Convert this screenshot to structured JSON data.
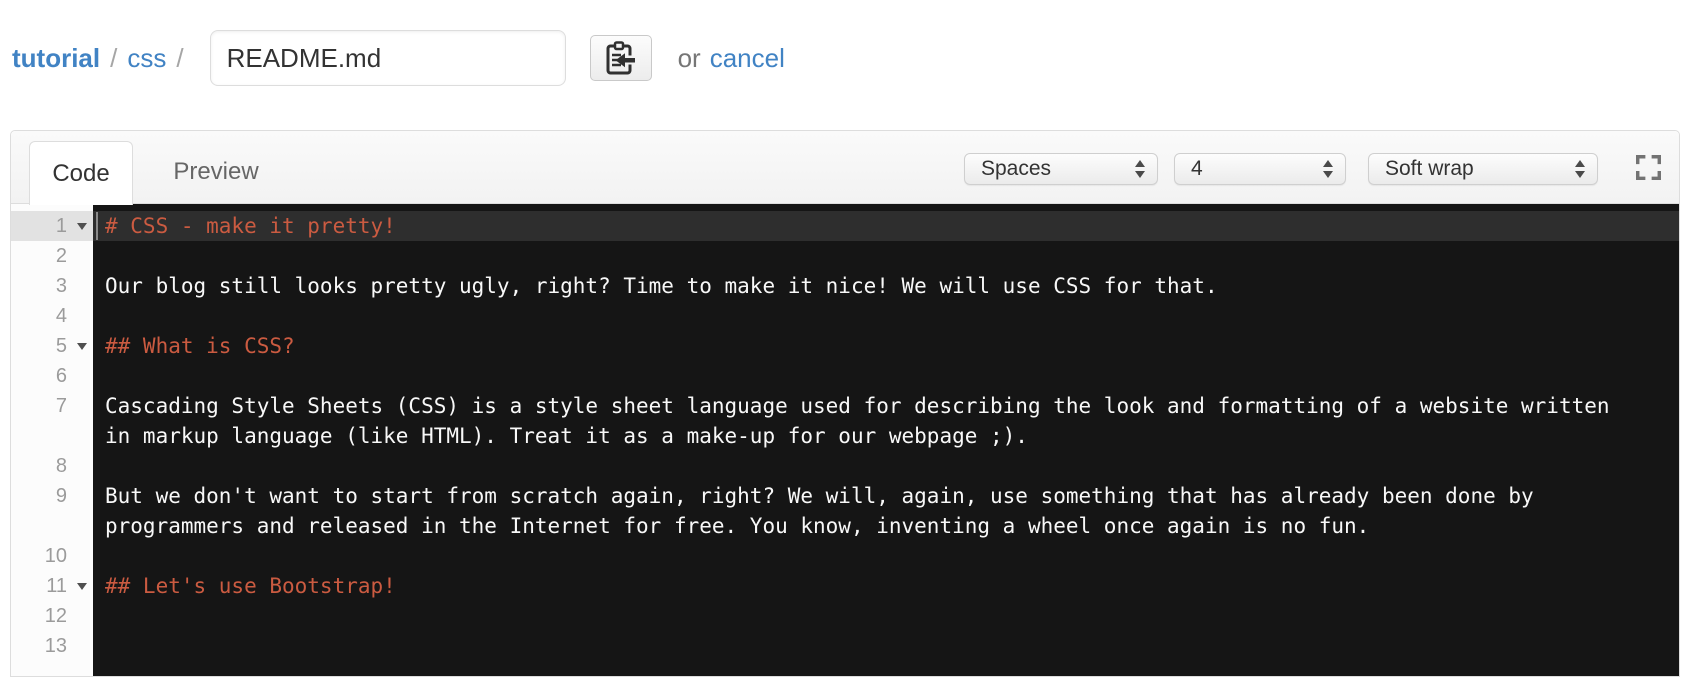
{
  "breadcrumb": {
    "repo_link": "tutorial",
    "separator1": "/",
    "path_link": "css",
    "separator2": "/",
    "filename_input": {
      "value": "README.md"
    },
    "or_text": "or",
    "cancel_link": "cancel"
  },
  "editor_panel": {
    "tabs": [
      {
        "label": "Code",
        "active": true
      },
      {
        "label": "Preview",
        "active": false
      }
    ],
    "toolbar": {
      "indent_mode_select": "Spaces",
      "indent_width_select": "4",
      "wrap_mode_select": "Soft wrap"
    }
  },
  "icons": {
    "paste_button": "clipboard-arrow-icon",
    "fullscreen": "screen-full-icon",
    "select_arrows": "up-down-arrows-icon",
    "fold": "triangle-down-icon"
  },
  "colors": {
    "link_blue": "#4183C4",
    "editor_background": "#151515",
    "active_line_background": "#2e2e2e",
    "heading_orange": "#CB5B41",
    "code_text": "#f8f8f8",
    "gutter_background": "#fcfcfc",
    "gutter_number": "#9b9b9b"
  },
  "editor": {
    "active_line_number": 1,
    "display_rows": [
      {
        "num": "1",
        "fold": true,
        "active": true,
        "kind": "heading",
        "text": "# CSS - make it pretty!"
      },
      {
        "num": "2",
        "text": ""
      },
      {
        "num": "3",
        "text": "Our blog still looks pretty ugly, right? Time to make it nice! We will use CSS for that."
      },
      {
        "num": "4",
        "text": ""
      },
      {
        "num": "5",
        "fold": true,
        "kind": "heading",
        "text": "## What is CSS?"
      },
      {
        "num": "6",
        "text": ""
      },
      {
        "num": "7",
        "text": "Cascading Style Sheets (CSS) is a style sheet language used for describing the look and formatting of a website written"
      },
      {
        "num": "",
        "text": "in markup language (like HTML). Treat it as a make-up for our webpage ;)."
      },
      {
        "num": "8",
        "text": ""
      },
      {
        "num": "9",
        "text": "But we don't want to start from scratch again, right? We will, again, use something that has already been done by"
      },
      {
        "num": "",
        "text": "programmers and released in the Internet for free. You know, inventing a wheel once again is no fun."
      },
      {
        "num": "10",
        "text": ""
      },
      {
        "num": "11",
        "fold": true,
        "kind": "heading",
        "text": "## Let's use Bootstrap!"
      },
      {
        "num": "12",
        "text": ""
      },
      {
        "num": "13",
        "text": ""
      }
    ]
  }
}
